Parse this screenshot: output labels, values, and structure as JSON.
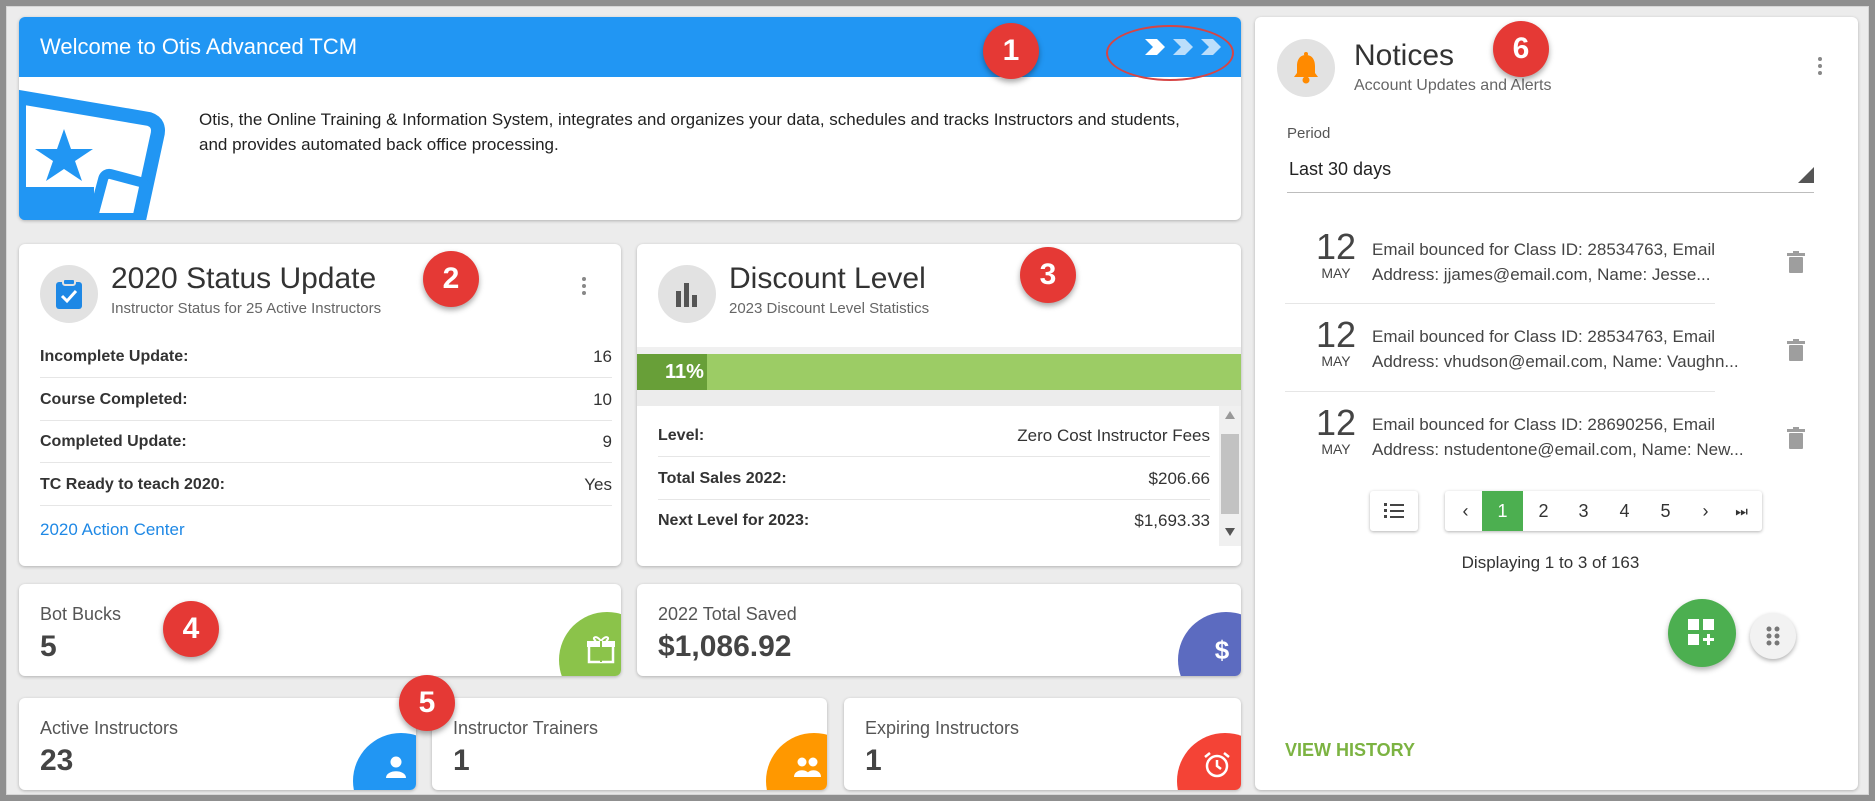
{
  "welcome": {
    "title": "Welcome to Otis Advanced TCM",
    "body": "Otis, the Online Training & Information System, integrates and organizes your data, schedules and tracks Instructors and students, and provides automated back office processing."
  },
  "badges": [
    "1",
    "2",
    "3",
    "4",
    "5",
    "6"
  ],
  "status_update": {
    "title": "2020 Status Update",
    "subtitle": "Instructor Status for 25 Active Instructors",
    "rows": [
      {
        "label": "Incomplete Update:",
        "value": "16"
      },
      {
        "label": "Course Completed:",
        "value": "10"
      },
      {
        "label": "Completed Update:",
        "value": "9"
      },
      {
        "label": "TC Ready to teach 2020:",
        "value": "Yes"
      }
    ],
    "link": "2020 Action Center"
  },
  "discount": {
    "title": "Discount Level",
    "subtitle": "2023 Discount Level Statistics",
    "progress_label": "11%",
    "progress": 0.11,
    "rows": [
      {
        "label": "Level:",
        "value": "Zero Cost Instructor Fees"
      },
      {
        "label": "Total Sales 2022:",
        "value": "$206.66"
      },
      {
        "label": "Next Level for 2023:",
        "value": "$1,693.33"
      }
    ]
  },
  "bot_bucks": {
    "label": "Bot Bucks",
    "value": "5"
  },
  "total_saved": {
    "label": "2022 Total Saved",
    "value": "$1,086.92"
  },
  "active_instructors": {
    "label": "Active Instructors",
    "value": "23"
  },
  "instructor_trainers": {
    "label": "Instructor Trainers",
    "value": "1"
  },
  "expiring_instructors": {
    "label": "Expiring Instructors",
    "value": "1"
  },
  "notices": {
    "title": "Notices",
    "subtitle": "Account Updates and Alerts",
    "period_label": "Period",
    "period_value": "Last 30 days",
    "items": [
      {
        "day": "12",
        "month": "MAY",
        "line1": "Email bounced for Class ID: 28534763, Email",
        "line2": "Address: jjames@email.com, Name: Jesse..."
      },
      {
        "day": "12",
        "month": "MAY",
        "line1": "Email bounced for Class ID: 28534763, Email",
        "line2": "Address: vhudson@email.com, Name: Vaughn..."
      },
      {
        "day": "12",
        "month": "MAY",
        "line1": "Email bounced for Class ID: 28690256, Email",
        "line2": "Address: nstudentone@email.com, Name: New..."
      }
    ],
    "pages": [
      "1",
      "2",
      "3",
      "4",
      "5"
    ],
    "prev": "‹",
    "next": "›",
    "last": "⏭",
    "displaying": "Displaying 1 to 3 of 163",
    "view_history": "VIEW HISTORY"
  },
  "colors": {
    "blue": "#2196f3",
    "green": "#8bc34a",
    "indigo": "#5c6bc0",
    "orange": "#ff9800",
    "red": "#f44336",
    "notice_orange": "#ff8a00",
    "fab_green": "#4caf50"
  }
}
